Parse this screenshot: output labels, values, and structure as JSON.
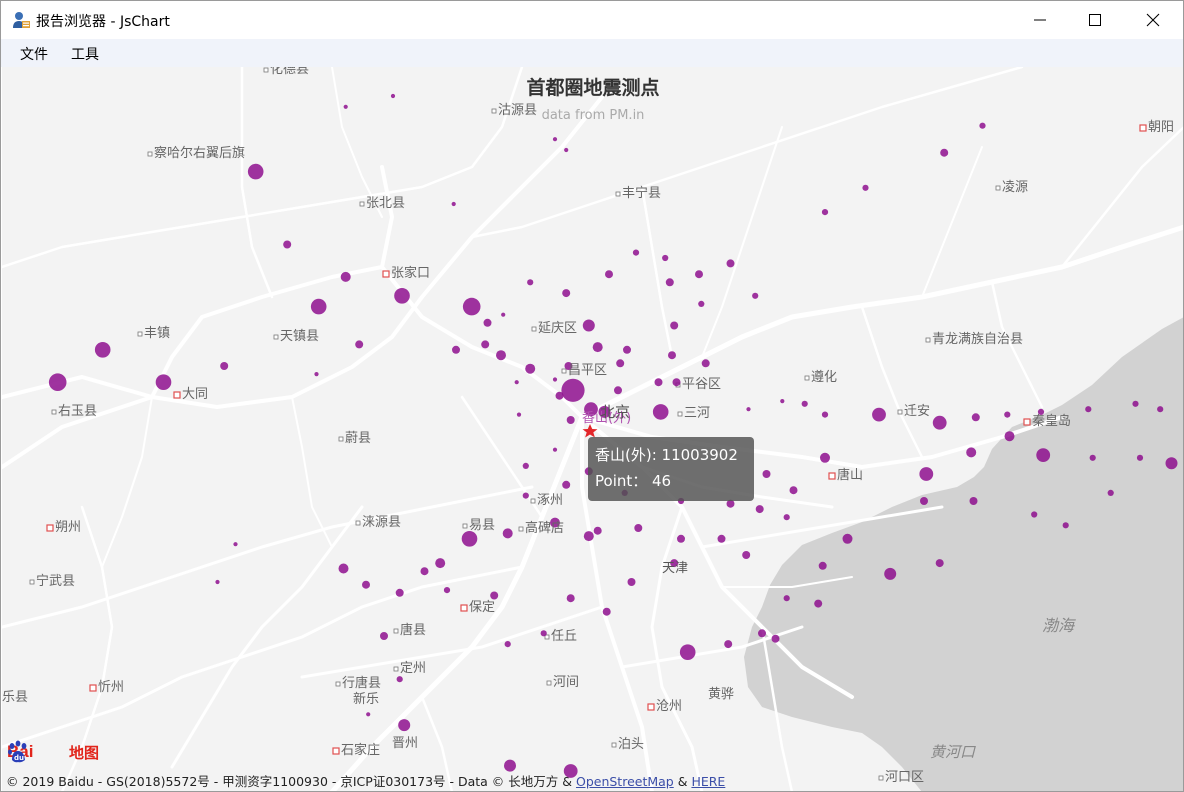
{
  "window": {
    "title": "报告浏览器 - JsChart",
    "icons": [
      "app-icon",
      "minimize-icon",
      "maximize-icon",
      "close-icon"
    ]
  },
  "menu": {
    "items": [
      "文件",
      "工具"
    ]
  },
  "map": {
    "title": "首都圈地震测点",
    "subtitle": "data from PM.in",
    "sea_label": "渤海",
    "place_labels": [
      "化德县",
      "沽源县",
      "朝阳",
      "察哈尔右翼后旗",
      "丰宁县",
      "凌源",
      "张北县",
      "张家口",
      "丰镇",
      "天镇县",
      "延庆区",
      "青龙满族自治县",
      "昌平区",
      "平谷区",
      "遵化",
      "大同",
      "右玉县",
      "北京",
      "三河",
      "迁安",
      "秦皇岛",
      "蔚县",
      "唐山",
      "涿州",
      "朔州",
      "涞源县",
      "易县",
      "高碑店",
      "宁武县",
      "天津",
      "保定",
      "唐县",
      "任丘",
      "定州",
      "行唐县",
      "河间",
      "新乐",
      "沧州",
      "黄骅",
      "忻州",
      "石家庄",
      "晋州",
      "泊头",
      "黄河口",
      "河口区",
      "乐县"
    ],
    "highlight_label": "香山(外)",
    "colors": {
      "marker": "#8e0f8e",
      "land": "#f3f3f3",
      "sea": "#d2d2d2",
      "road": "#ffffff",
      "highlight_star": "#e3262a",
      "highlight_text": "#b052b0"
    },
    "tooltip": {
      "line1": "香山(外): 11003902",
      "line2": "Point：  46"
    },
    "logo": {
      "part1": "Bai",
      "part2": "地图"
    },
    "copyright": {
      "text": "© 2019 Baidu - GS(2018)5572号 - 甲测资字1100930 - 京ICP证030173号 - Data © 长地万方 & ",
      "link1": "OpenStreetMap",
      "sep": " & ",
      "link2": "HERE"
    },
    "seismic_points": [
      {
        "lng": 116.05,
        "lat": 41.6,
        "size": 1
      },
      {
        "lng": 116.82,
        "lat": 41.92,
        "size": 1
      },
      {
        "lng": 114.7,
        "lat": 41.22,
        "size": 1
      },
      {
        "lng": 115.35,
        "lat": 41.06,
        "size": 1
      },
      {
        "lng": 115.56,
        "lat": 41.1,
        "size": 1
      },
      {
        "lng": 116.28,
        "lat": 40.94,
        "size": 1
      },
      {
        "lng": 116.33,
        "lat": 40.9,
        "size": 1
      },
      {
        "lng": 118.18,
        "lat": 40.99,
        "size": 2
      },
      {
        "lng": 118.01,
        "lat": 40.89,
        "size": 3
      },
      {
        "lng": 117.66,
        "lat": 40.76,
        "size": 2
      },
      {
        "lng": 117.48,
        "lat": 40.67,
        "size": 2
      },
      {
        "lng": 114.95,
        "lat": 40.82,
        "size": 7
      },
      {
        "lng": 115.83,
        "lat": 40.7,
        "size": 1
      },
      {
        "lng": 115.09,
        "lat": 40.55,
        "size": 3
      },
      {
        "lng": 115.35,
        "lat": 40.43,
        "size": 4
      },
      {
        "lng": 115.6,
        "lat": 40.36,
        "size": 7
      },
      {
        "lng": 115.23,
        "lat": 40.32,
        "size": 7
      },
      {
        "lng": 115.91,
        "lat": 40.32,
        "size": 8
      },
      {
        "lng": 115.98,
        "lat": 40.26,
        "size": 3
      },
      {
        "lng": 116.17,
        "lat": 40.41,
        "size": 2
      },
      {
        "lng": 116.64,
        "lat": 40.52,
        "size": 2
      },
      {
        "lng": 116.77,
        "lat": 40.5,
        "size": 2
      },
      {
        "lng": 116.92,
        "lat": 40.44,
        "size": 3
      },
      {
        "lng": 117.06,
        "lat": 40.48,
        "size": 3
      },
      {
        "lng": 116.52,
        "lat": 40.44,
        "size": 3
      },
      {
        "lng": 116.79,
        "lat": 40.41,
        "size": 3
      },
      {
        "lng": 116.33,
        "lat": 40.37,
        "size": 3
      },
      {
        "lng": 116.05,
        "lat": 40.29,
        "size": 1
      },
      {
        "lng": 116.93,
        "lat": 40.33,
        "size": 2
      },
      {
        "lng": 117.17,
        "lat": 40.36,
        "size": 2
      },
      {
        "lng": 116.81,
        "lat": 40.25,
        "size": 3
      },
      {
        "lng": 116.43,
        "lat": 40.25,
        "size": 5
      },
      {
        "lng": 116.47,
        "lat": 40.17,
        "size": 4
      },
      {
        "lng": 116.6,
        "lat": 40.16,
        "size": 3
      },
      {
        "lng": 116.8,
        "lat": 40.14,
        "size": 3
      },
      {
        "lng": 116.95,
        "lat": 40.11,
        "size": 3
      },
      {
        "lng": 115.84,
        "lat": 40.16,
        "size": 3
      },
      {
        "lng": 115.97,
        "lat": 40.18,
        "size": 3
      },
      {
        "lng": 116.04,
        "lat": 40.14,
        "size": 4
      },
      {
        "lng": 116.17,
        "lat": 40.09,
        "size": 4
      },
      {
        "lng": 116.34,
        "lat": 40.1,
        "size": 3
      },
      {
        "lng": 116.57,
        "lat": 40.11,
        "size": 3
      },
      {
        "lng": 116.74,
        "lat": 40.04,
        "size": 3
      },
      {
        "lng": 114.27,
        "lat": 40.16,
        "size": 7
      },
      {
        "lng": 115.41,
        "lat": 40.18,
        "size": 3
      },
      {
        "lng": 115.22,
        "lat": 40.07,
        "size": 1
      },
      {
        "lng": 113.49,
        "lat": 40.1,
        "size": 6
      },
      {
        "lng": 113.76,
        "lat": 40.08,
        "size": 6
      },
      {
        "lng": 114.07,
        "lat": 40.04,
        "size": 8
      },
      {
        "lng": 114.54,
        "lat": 40.04,
        "size": 7
      },
      {
        "lng": 114.81,
        "lat": 40.1,
        "size": 3
      },
      {
        "lng": 116.11,
        "lat": 40.04,
        "size": 1
      },
      {
        "lng": 116.28,
        "lat": 40.05,
        "size": 1
      },
      {
        "lng": 116.36,
        "lat": 40.01,
        "size": 11
      },
      {
        "lng": 116.56,
        "lat": 40.01,
        "size": 3
      },
      {
        "lng": 116.82,
        "lat": 40.04,
        "size": 3
      },
      {
        "lng": 116.3,
        "lat": 39.99,
        "size": 3
      },
      {
        "lng": 116.44,
        "lat": 39.94,
        "size": 6
      },
      {
        "lng": 116.5,
        "lat": 39.93,
        "size": 5
      },
      {
        "lng": 116.75,
        "lat": 39.93,
        "size": 7
      },
      {
        "lng": 116.12,
        "lat": 39.92,
        "size": 1
      },
      {
        "lng": 116.35,
        "lat": 39.9,
        "size": 3
      },
      {
        "lng": 116.28,
        "lat": 39.79,
        "size": 1
      },
      {
        "lng": 116.15,
        "lat": 39.73,
        "size": 2
      },
      {
        "lng": 116.43,
        "lat": 39.71,
        "size": 3
      },
      {
        "lng": 117.14,
        "lat": 39.94,
        "size": 1
      },
      {
        "lng": 117.29,
        "lat": 39.97,
        "size": 1
      },
      {
        "lng": 117.39,
        "lat": 39.96,
        "size": 2
      },
      {
        "lng": 117.48,
        "lat": 39.92,
        "size": 2
      },
      {
        "lng": 117.72,
        "lat": 39.92,
        "size": 6
      },
      {
        "lng": 117.99,
        "lat": 39.89,
        "size": 6
      },
      {
        "lng": 118.15,
        "lat": 39.91,
        "size": 3
      },
      {
        "lng": 118.29,
        "lat": 39.92,
        "size": 2
      },
      {
        "lng": 118.44,
        "lat": 39.93,
        "size": 2
      },
      {
        "lng": 118.65,
        "lat": 39.94,
        "size": 2
      },
      {
        "lng": 118.86,
        "lat": 39.96,
        "size": 2
      },
      {
        "lng": 118.97,
        "lat": 39.94,
        "size": 2
      },
      {
        "lng": 119.17,
        "lat": 39.96,
        "size": 2
      },
      {
        "lng": 119.26,
        "lat": 39.97,
        "size": 2
      },
      {
        "lng": 119.53,
        "lat": 40.01,
        "size": 3
      },
      {
        "lng": 119.52,
        "lat": 39.88,
        "size": 2
      },
      {
        "lng": 118.3,
        "lat": 39.84,
        "size": 4
      },
      {
        "lng": 118.45,
        "lat": 39.77,
        "size": 6
      },
      {
        "lng": 118.67,
        "lat": 39.76,
        "size": 2
      },
      {
        "lng": 118.88,
        "lat": 39.76,
        "size": 2
      },
      {
        "lng": 119.02,
        "lat": 39.74,
        "size": 5
      },
      {
        "lng": 117.93,
        "lat": 39.7,
        "size": 6
      },
      {
        "lng": 117.92,
        "lat": 39.6,
        "size": 3
      },
      {
        "lng": 118.13,
        "lat": 39.78,
        "size": 4
      },
      {
        "lng": 118.14,
        "lat": 39.6,
        "size": 3
      },
      {
        "lng": 117.48,
        "lat": 39.76,
        "size": 4
      },
      {
        "lng": 117.34,
        "lat": 39.64,
        "size": 3
      },
      {
        "lng": 117.22,
        "lat": 39.7,
        "size": 3
      },
      {
        "lng": 118.41,
        "lat": 39.55,
        "size": 2
      },
      {
        "lng": 118.55,
        "lat": 39.51,
        "size": 2
      },
      {
        "lng": 118.75,
        "lat": 39.63,
        "size": 2
      },
      {
        "lng": 117.58,
        "lat": 39.46,
        "size": 4
      },
      {
        "lng": 117.47,
        "lat": 39.36,
        "size": 3
      },
      {
        "lng": 117.77,
        "lat": 39.33,
        "size": 5
      },
      {
        "lng": 117.99,
        "lat": 39.37,
        "size": 3
      },
      {
        "lng": 116.15,
        "lat": 39.62,
        "size": 2
      },
      {
        "lng": 116.33,
        "lat": 39.66,
        "size": 3
      },
      {
        "lng": 116.59,
        "lat": 39.63,
        "size": 2
      },
      {
        "lng": 116.84,
        "lat": 39.6,
        "size": 2
      },
      {
        "lng": 117.06,
        "lat": 39.59,
        "size": 3
      },
      {
        "lng": 117.19,
        "lat": 39.57,
        "size": 3
      },
      {
        "lng": 117.31,
        "lat": 39.54,
        "size": 2
      },
      {
        "lng": 115.9,
        "lat": 39.46,
        "size": 7
      },
      {
        "lng": 116.07,
        "lat": 39.48,
        "size": 4
      },
      {
        "lng": 116.28,
        "lat": 39.52,
        "size": 4
      },
      {
        "lng": 116.47,
        "lat": 39.49,
        "size": 3
      },
      {
        "lng": 116.65,
        "lat": 39.5,
        "size": 3
      },
      {
        "lng": 116.84,
        "lat": 39.46,
        "size": 3
      },
      {
        "lng": 117.02,
        "lat": 39.46,
        "size": 3
      },
      {
        "lng": 117.13,
        "lat": 39.4,
        "size": 3
      },
      {
        "lng": 116.43,
        "lat": 39.47,
        "size": 4
      },
      {
        "lng": 116.81,
        "lat": 39.37,
        "size": 3
      },
      {
        "lng": 116.62,
        "lat": 39.3,
        "size": 3
      },
      {
        "lng": 116.35,
        "lat": 39.24,
        "size": 3
      },
      {
        "lng": 116.01,
        "lat": 39.25,
        "size": 3
      },
      {
        "lng": 115.8,
        "lat": 39.27,
        "size": 2
      },
      {
        "lng": 115.59,
        "lat": 39.26,
        "size": 3
      },
      {
        "lng": 115.44,
        "lat": 39.29,
        "size": 3
      },
      {
        "lng": 115.34,
        "lat": 39.35,
        "size": 4
      },
      {
        "lng": 114.78,
        "lat": 39.3,
        "size": 1
      },
      {
        "lng": 114.86,
        "lat": 39.44,
        "size": 1
      },
      {
        "lng": 115.77,
        "lat": 39.37,
        "size": 4
      },
      {
        "lng": 115.7,
        "lat": 39.34,
        "size": 3
      },
      {
        "lng": 116.23,
        "lat": 39.11,
        "size": 2
      },
      {
        "lng": 116.51,
        "lat": 39.19,
        "size": 3
      },
      {
        "lng": 117.2,
        "lat": 39.11,
        "size": 3
      },
      {
        "lng": 117.31,
        "lat": 39.24,
        "size": 2
      },
      {
        "lng": 117.45,
        "lat": 39.22,
        "size": 3
      },
      {
        "lng": 117.05,
        "lat": 39.07,
        "size": 3
      },
      {
        "lng": 116.87,
        "lat": 39.04,
        "size": 7
      },
      {
        "lng": 117.26,
        "lat": 39.09,
        "size": 3
      },
      {
        "lng": 116.07,
        "lat": 39.07,
        "size": 2
      },
      {
        "lng": 115.52,
        "lat": 39.1,
        "size": 3
      },
      {
        "lng": 115.59,
        "lat": 38.94,
        "size": 2
      },
      {
        "lng": 115.45,
        "lat": 38.81,
        "size": 1
      },
      {
        "lng": 115.61,
        "lat": 38.77,
        "size": 5
      },
      {
        "lng": 116.08,
        "lat": 38.62,
        "size": 5
      },
      {
        "lng": 116.35,
        "lat": 38.6,
        "size": 6
      }
    ]
  }
}
